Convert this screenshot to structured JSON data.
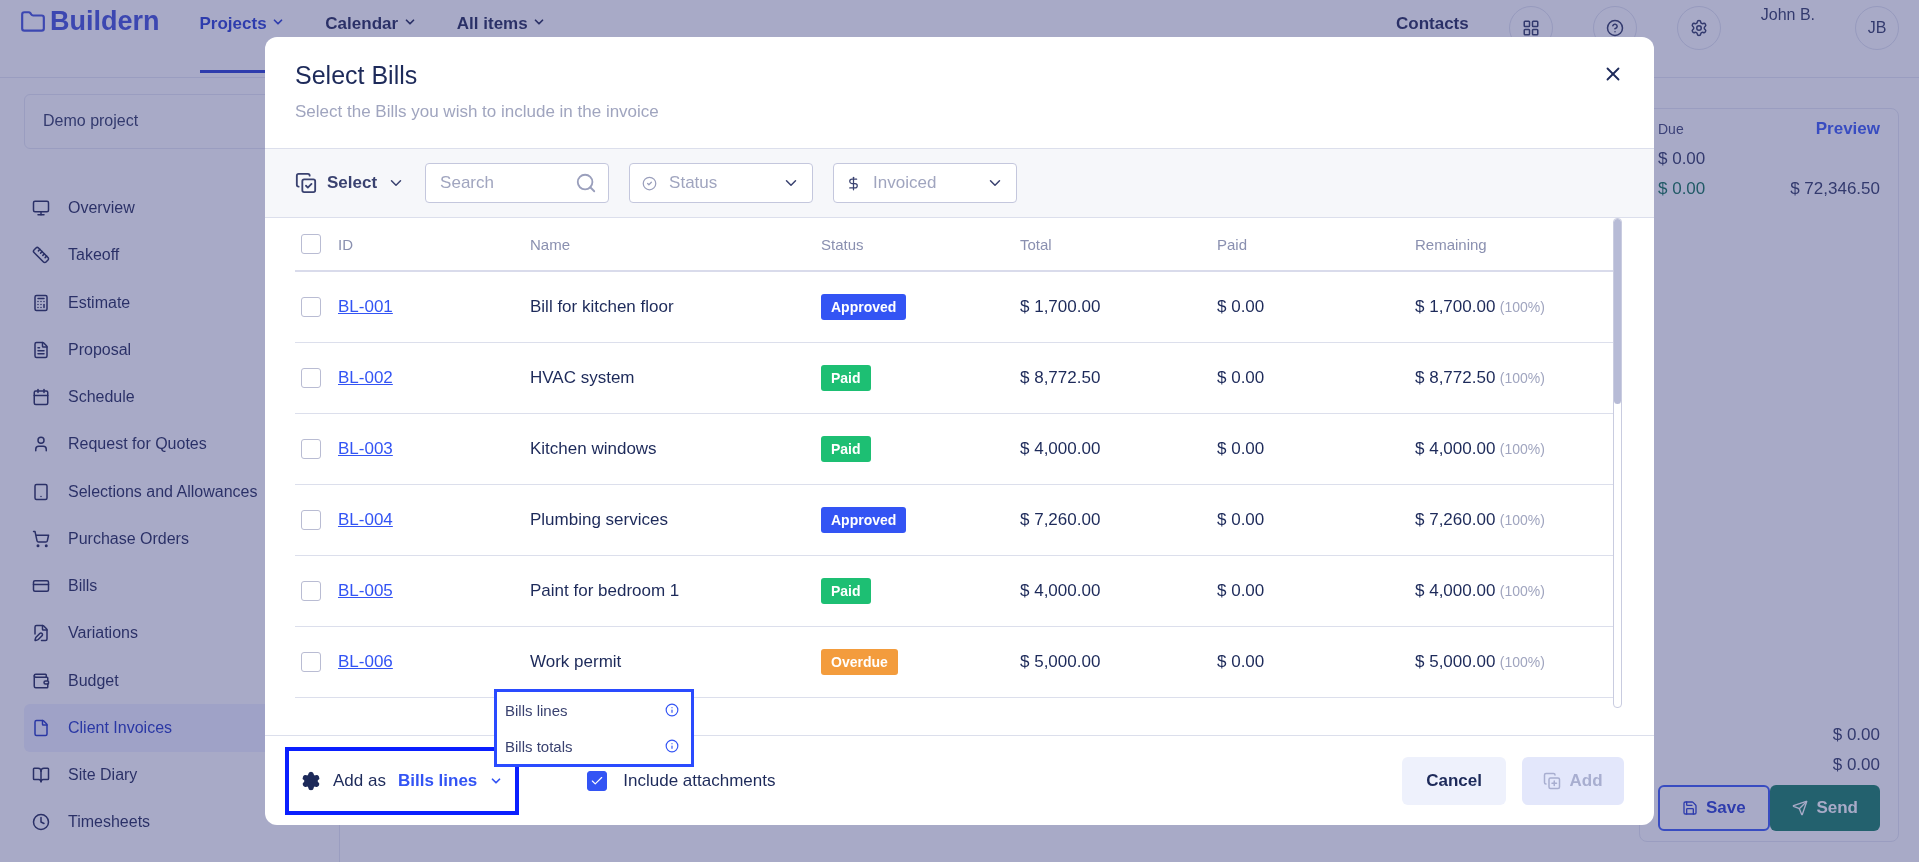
{
  "app": {
    "logo": "Buildern",
    "nav": [
      {
        "label": "Projects",
        "selected": true
      },
      {
        "label": "Calendar",
        "selected": false
      },
      {
        "label": "All items",
        "selected": false
      }
    ],
    "contacts": "Contacts",
    "user": "John B.",
    "avatar": "JB"
  },
  "sidebar": {
    "project": "Demo project",
    "items": [
      {
        "label": "Overview",
        "selected": false
      },
      {
        "label": "Takeoff",
        "selected": false
      },
      {
        "label": "Estimate",
        "selected": false
      },
      {
        "label": "Proposal",
        "selected": false
      },
      {
        "label": "Schedule",
        "selected": false
      },
      {
        "label": "Request for Quotes",
        "selected": false
      },
      {
        "label": "Selections and Allowances",
        "selected": false
      },
      {
        "label": "Purchase Orders",
        "selected": false
      },
      {
        "label": "Bills",
        "selected": false
      },
      {
        "label": "Variations",
        "selected": false
      },
      {
        "label": "Budget",
        "selected": false
      },
      {
        "label": "Client Invoices",
        "selected": true
      },
      {
        "label": "Site Diary",
        "selected": false
      },
      {
        "label": "Timesheets",
        "selected": false
      }
    ]
  },
  "invoice_panel": {
    "due_label": "Due",
    "due": "$ 0.00",
    "preview": "Preview",
    "paid": "$ 0.00",
    "remaining": "$ 72,346.50",
    "line_totals": [
      "$ 0.00",
      "$ 0.00"
    ],
    "save": "Save",
    "send": "Send"
  },
  "dialog": {
    "title": "Select Bills",
    "subtitle": "Select the Bills you wish to include in the invoice",
    "toolbar": {
      "select": "Select",
      "search_placeholder": "Search",
      "status_placeholder": "Status",
      "invoiced_placeholder": "Invoiced"
    },
    "columns": [
      "ID",
      "Name",
      "Status",
      "Total",
      "Paid",
      "Remaining"
    ],
    "header_checked": false,
    "rows": [
      {
        "id": "BL-001",
        "name": "Bill for kitchen floor",
        "status": {
          "label": "Approved",
          "color": "#3354f4"
        },
        "total": "$ 1,700.00",
        "paid": "$ 0.00",
        "remaining": "$ 1,700.00",
        "percent": "(100%)",
        "checked": false
      },
      {
        "id": "BL-002",
        "name": "HVAC system",
        "status": {
          "label": "Paid",
          "color": "#1dbf73"
        },
        "total": "$ 8,772.50",
        "paid": "$ 0.00",
        "remaining": "$ 8,772.50",
        "percent": "(100%)",
        "checked": false
      },
      {
        "id": "BL-003",
        "name": "Kitchen windows",
        "status": {
          "label": "Paid",
          "color": "#1dbf73"
        },
        "total": "$ 4,000.00",
        "paid": "$ 0.00",
        "remaining": "$ 4,000.00",
        "percent": "(100%)",
        "checked": false
      },
      {
        "id": "BL-004",
        "name": "Plumbing services",
        "status": {
          "label": "Approved",
          "color": "#3354f4"
        },
        "total": "$ 7,260.00",
        "paid": "$ 0.00",
        "remaining": "$ 7,260.00",
        "percent": "(100%)",
        "checked": false
      },
      {
        "id": "BL-005",
        "name": "Paint for bedroom 1",
        "status": {
          "label": "Paid",
          "color": "#1dbf73"
        },
        "total": "$ 4,000.00",
        "paid": "$ 0.00",
        "remaining": "$ 4,000.00",
        "percent": "(100%)",
        "checked": false
      },
      {
        "id": "BL-006",
        "name": "Work permit",
        "status": {
          "label": "Overdue",
          "color": "#f39c3d"
        },
        "total": "$ 5,000.00",
        "paid": "$ 0.00",
        "remaining": "$ 5,000.00",
        "percent": "(100%)",
        "checked": false
      }
    ],
    "add_as": {
      "label": "Add as",
      "value": "Bills lines",
      "options": [
        "Bills lines",
        "Bills totals"
      ]
    },
    "include_attachments": {
      "label": "Include attachments",
      "checked": true
    },
    "cancel": "Cancel",
    "add": {
      "label": "Add",
      "disabled": true
    }
  }
}
